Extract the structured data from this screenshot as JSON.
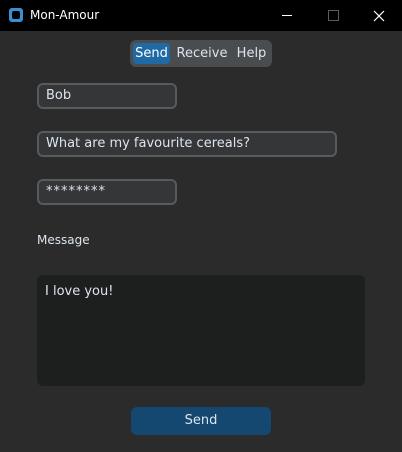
{
  "window": {
    "title": "Mon-Amour",
    "icon": "app-icon"
  },
  "tabs": [
    {
      "label": "Send",
      "active": true
    },
    {
      "label": "Receive",
      "active": false
    },
    {
      "label": "Help",
      "active": false
    }
  ],
  "form": {
    "name_value": "Bob",
    "question_value": "What are my favourite cereals?",
    "password_value": "********",
    "message_label": "Message",
    "message_value": "I love you!",
    "send_label": "Send"
  },
  "colors": {
    "accent": "#1f6aa5",
    "button": "#144870",
    "background": "#2b2b2b",
    "titlebar": "#000000"
  }
}
